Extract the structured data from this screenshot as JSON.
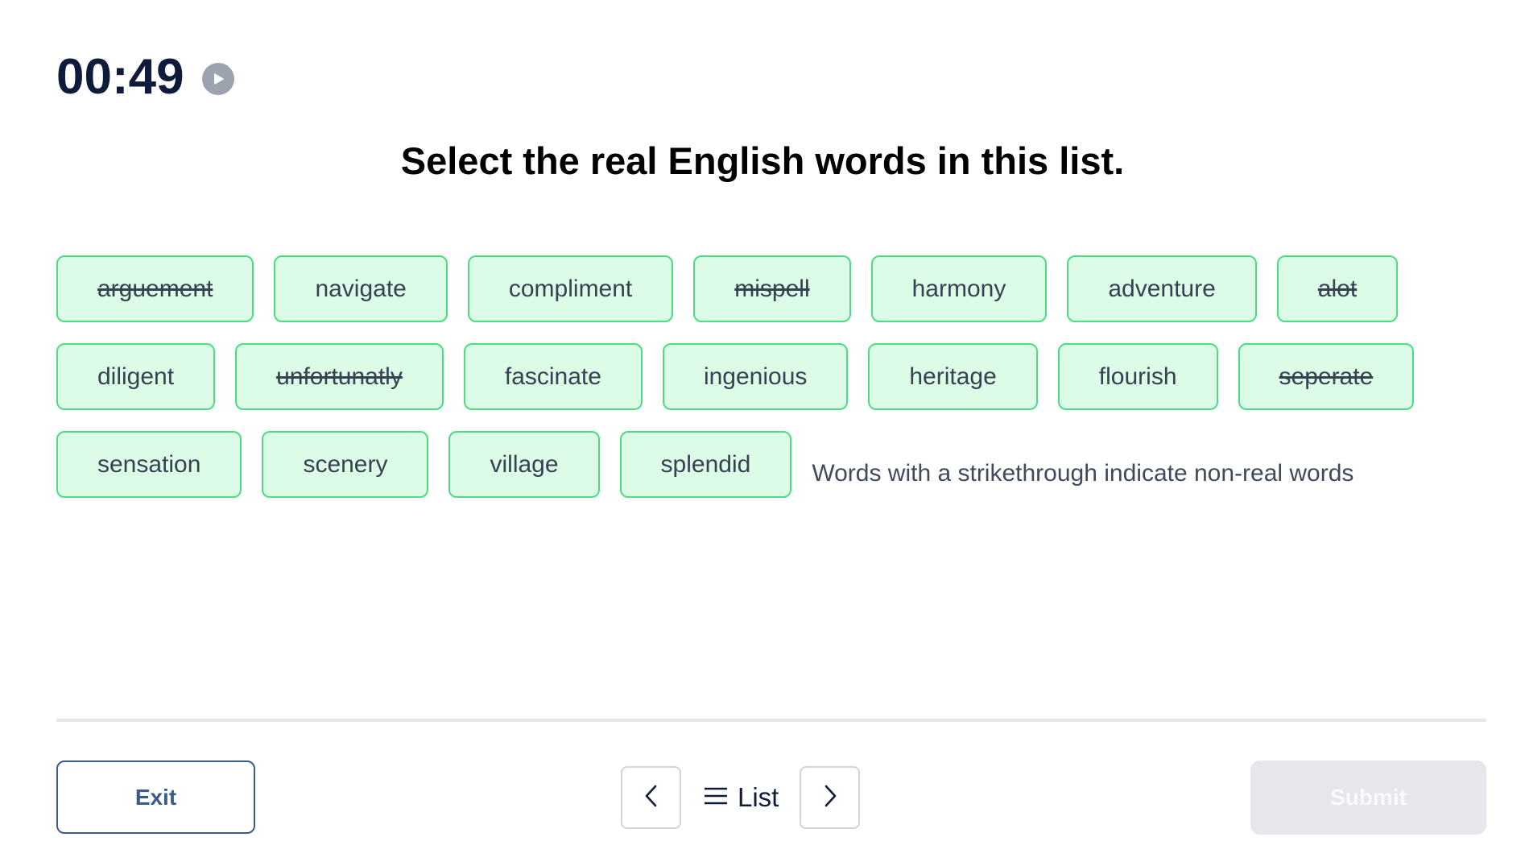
{
  "timer": {
    "value": "00:49",
    "play_icon": "play-circle-icon"
  },
  "question": {
    "title": "Select the real English words in this list."
  },
  "words": [
    {
      "label": "arguement",
      "struck": true
    },
    {
      "label": "navigate",
      "struck": false
    },
    {
      "label": "compliment",
      "struck": false
    },
    {
      "label": "mispell",
      "struck": true
    },
    {
      "label": "harmony",
      "struck": false
    },
    {
      "label": "adventure",
      "struck": false
    },
    {
      "label": "alot",
      "struck": true
    },
    {
      "label": "diligent",
      "struck": false
    },
    {
      "label": "unfortunatly",
      "struck": true
    },
    {
      "label": "fascinate",
      "struck": false
    },
    {
      "label": "ingenious",
      "struck": false
    },
    {
      "label": "heritage",
      "struck": false
    },
    {
      "label": "flourish",
      "struck": false
    },
    {
      "label": "seperate",
      "struck": true
    },
    {
      "label": "sensation",
      "struck": false
    },
    {
      "label": "scenery",
      "struck": false
    },
    {
      "label": "village",
      "struck": false
    },
    {
      "label": "splendid",
      "struck": false
    }
  ],
  "note": "Words with a strikethrough indicate non-real words",
  "footer": {
    "exit_label": "Exit",
    "prev_icon": "chevron-left-icon",
    "list_icon": "hamburger-menu-icon",
    "list_label": "List",
    "next_icon": "chevron-right-icon",
    "submit_label": "Submit",
    "submit_disabled": true
  },
  "colors": {
    "timer_text": "#0f1b3a",
    "chip_border": "#4ade80",
    "chip_fill": "#dcfce7",
    "chip_text": "#374151",
    "exit_accent": "#3b5b8a",
    "submit_disabled_bg": "#e5e7eb",
    "submit_disabled_text": "#f9fafb",
    "play_icon_bg": "#9ca3af"
  }
}
